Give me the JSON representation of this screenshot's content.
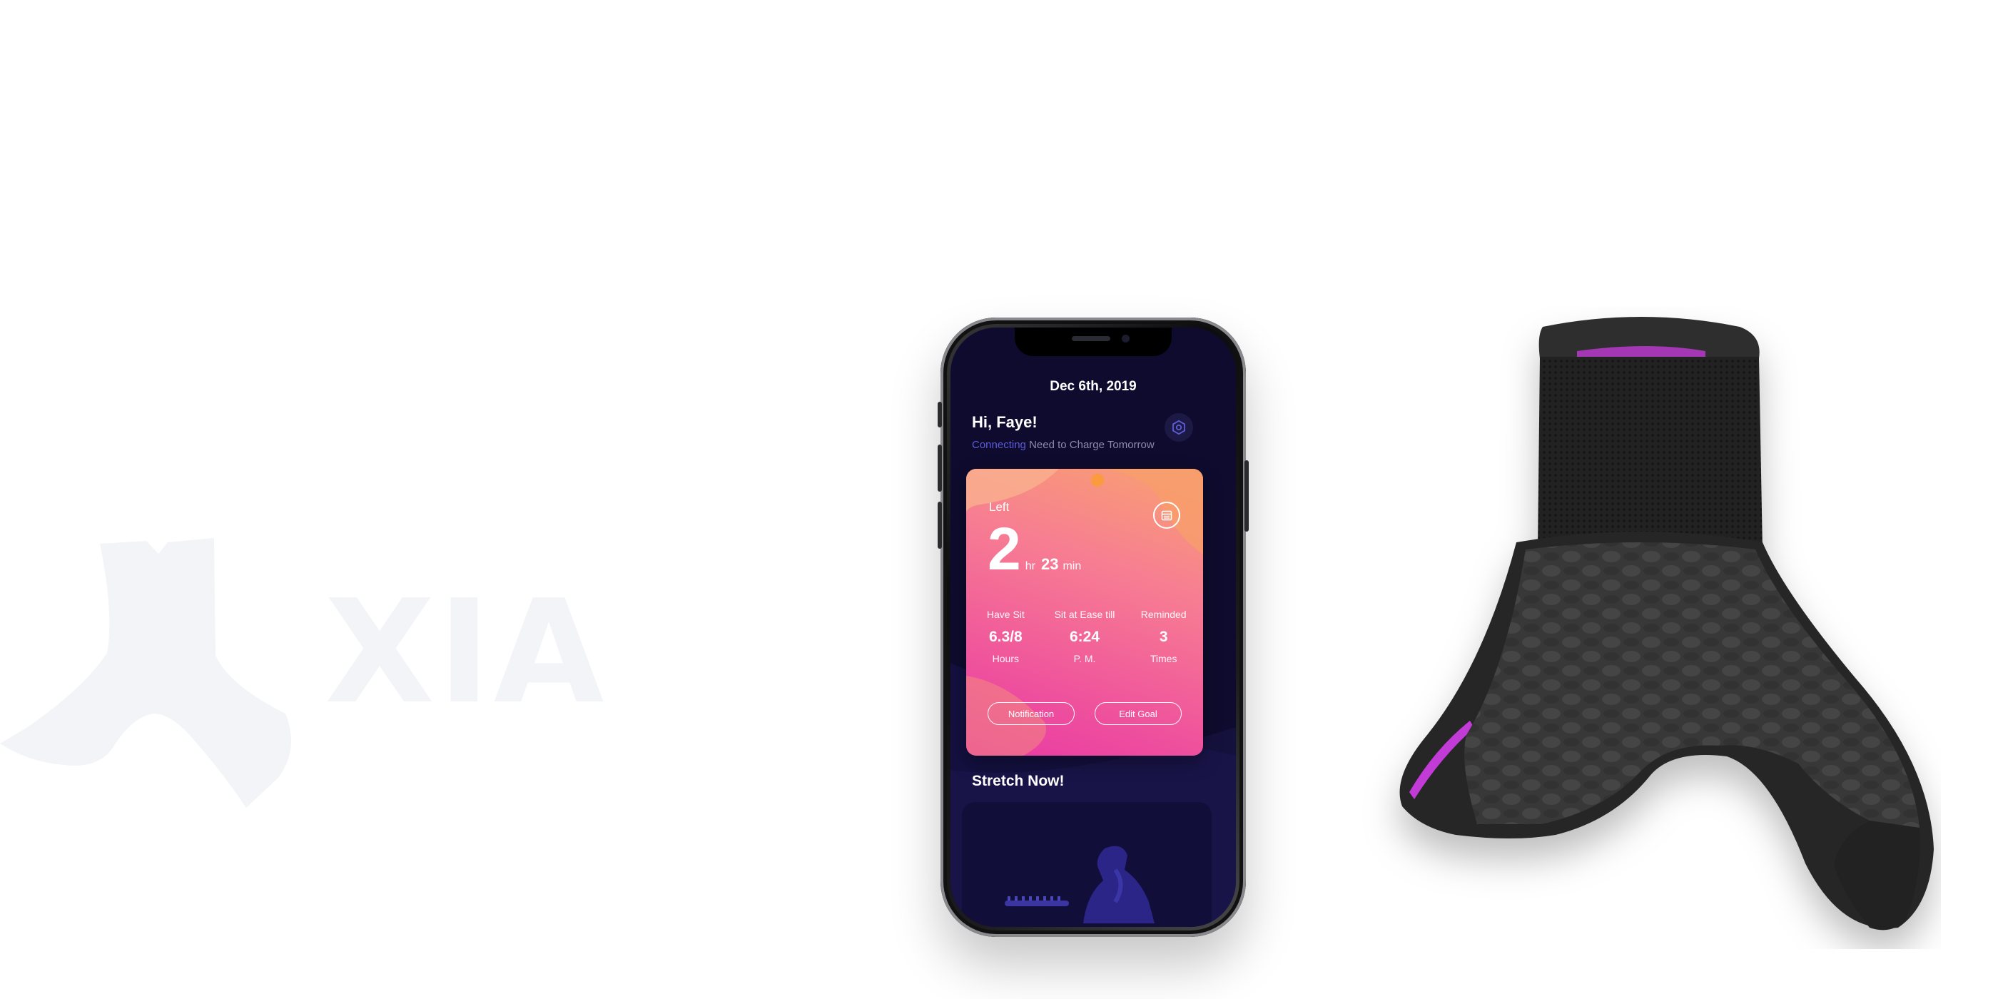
{
  "brand": {
    "watermark_text": "XIA"
  },
  "app": {
    "date": "Dec 6th, 2019",
    "greeting": "Hi, Faye!",
    "status_connecting": "Connecting",
    "status_message": "Need to Charge Tomorrow",
    "card": {
      "left_label": "Left",
      "hours_value": "2",
      "hours_unit": "hr",
      "minutes_value": "23",
      "minutes_unit": "min",
      "stats": [
        {
          "label": "Have Sit",
          "value": "6.3/8",
          "unit": "Hours"
        },
        {
          "label": "Sit at Ease till",
          "value": "6:24",
          "unit": "P. M."
        },
        {
          "label": "Reminded",
          "value": "3",
          "unit": "Times"
        }
      ],
      "notification_label": "Notification",
      "edit_goal_label": "Edit Goal"
    },
    "stretch_title": "Stretch Now!"
  },
  "colors": {
    "screen_bg": "#0e0b2e",
    "accent": "#5d5cd6",
    "card_gradient_start": "#f8a270",
    "card_gradient_end": "#e93aa5",
    "cushion_mesh": "#232323",
    "cushion_pad": "#3a3a3a",
    "cushion_accent": "#c23ad6",
    "watermark": "#f3f4f7"
  },
  "icons": [
    "gear-icon",
    "calendar-icon",
    "notch"
  ]
}
